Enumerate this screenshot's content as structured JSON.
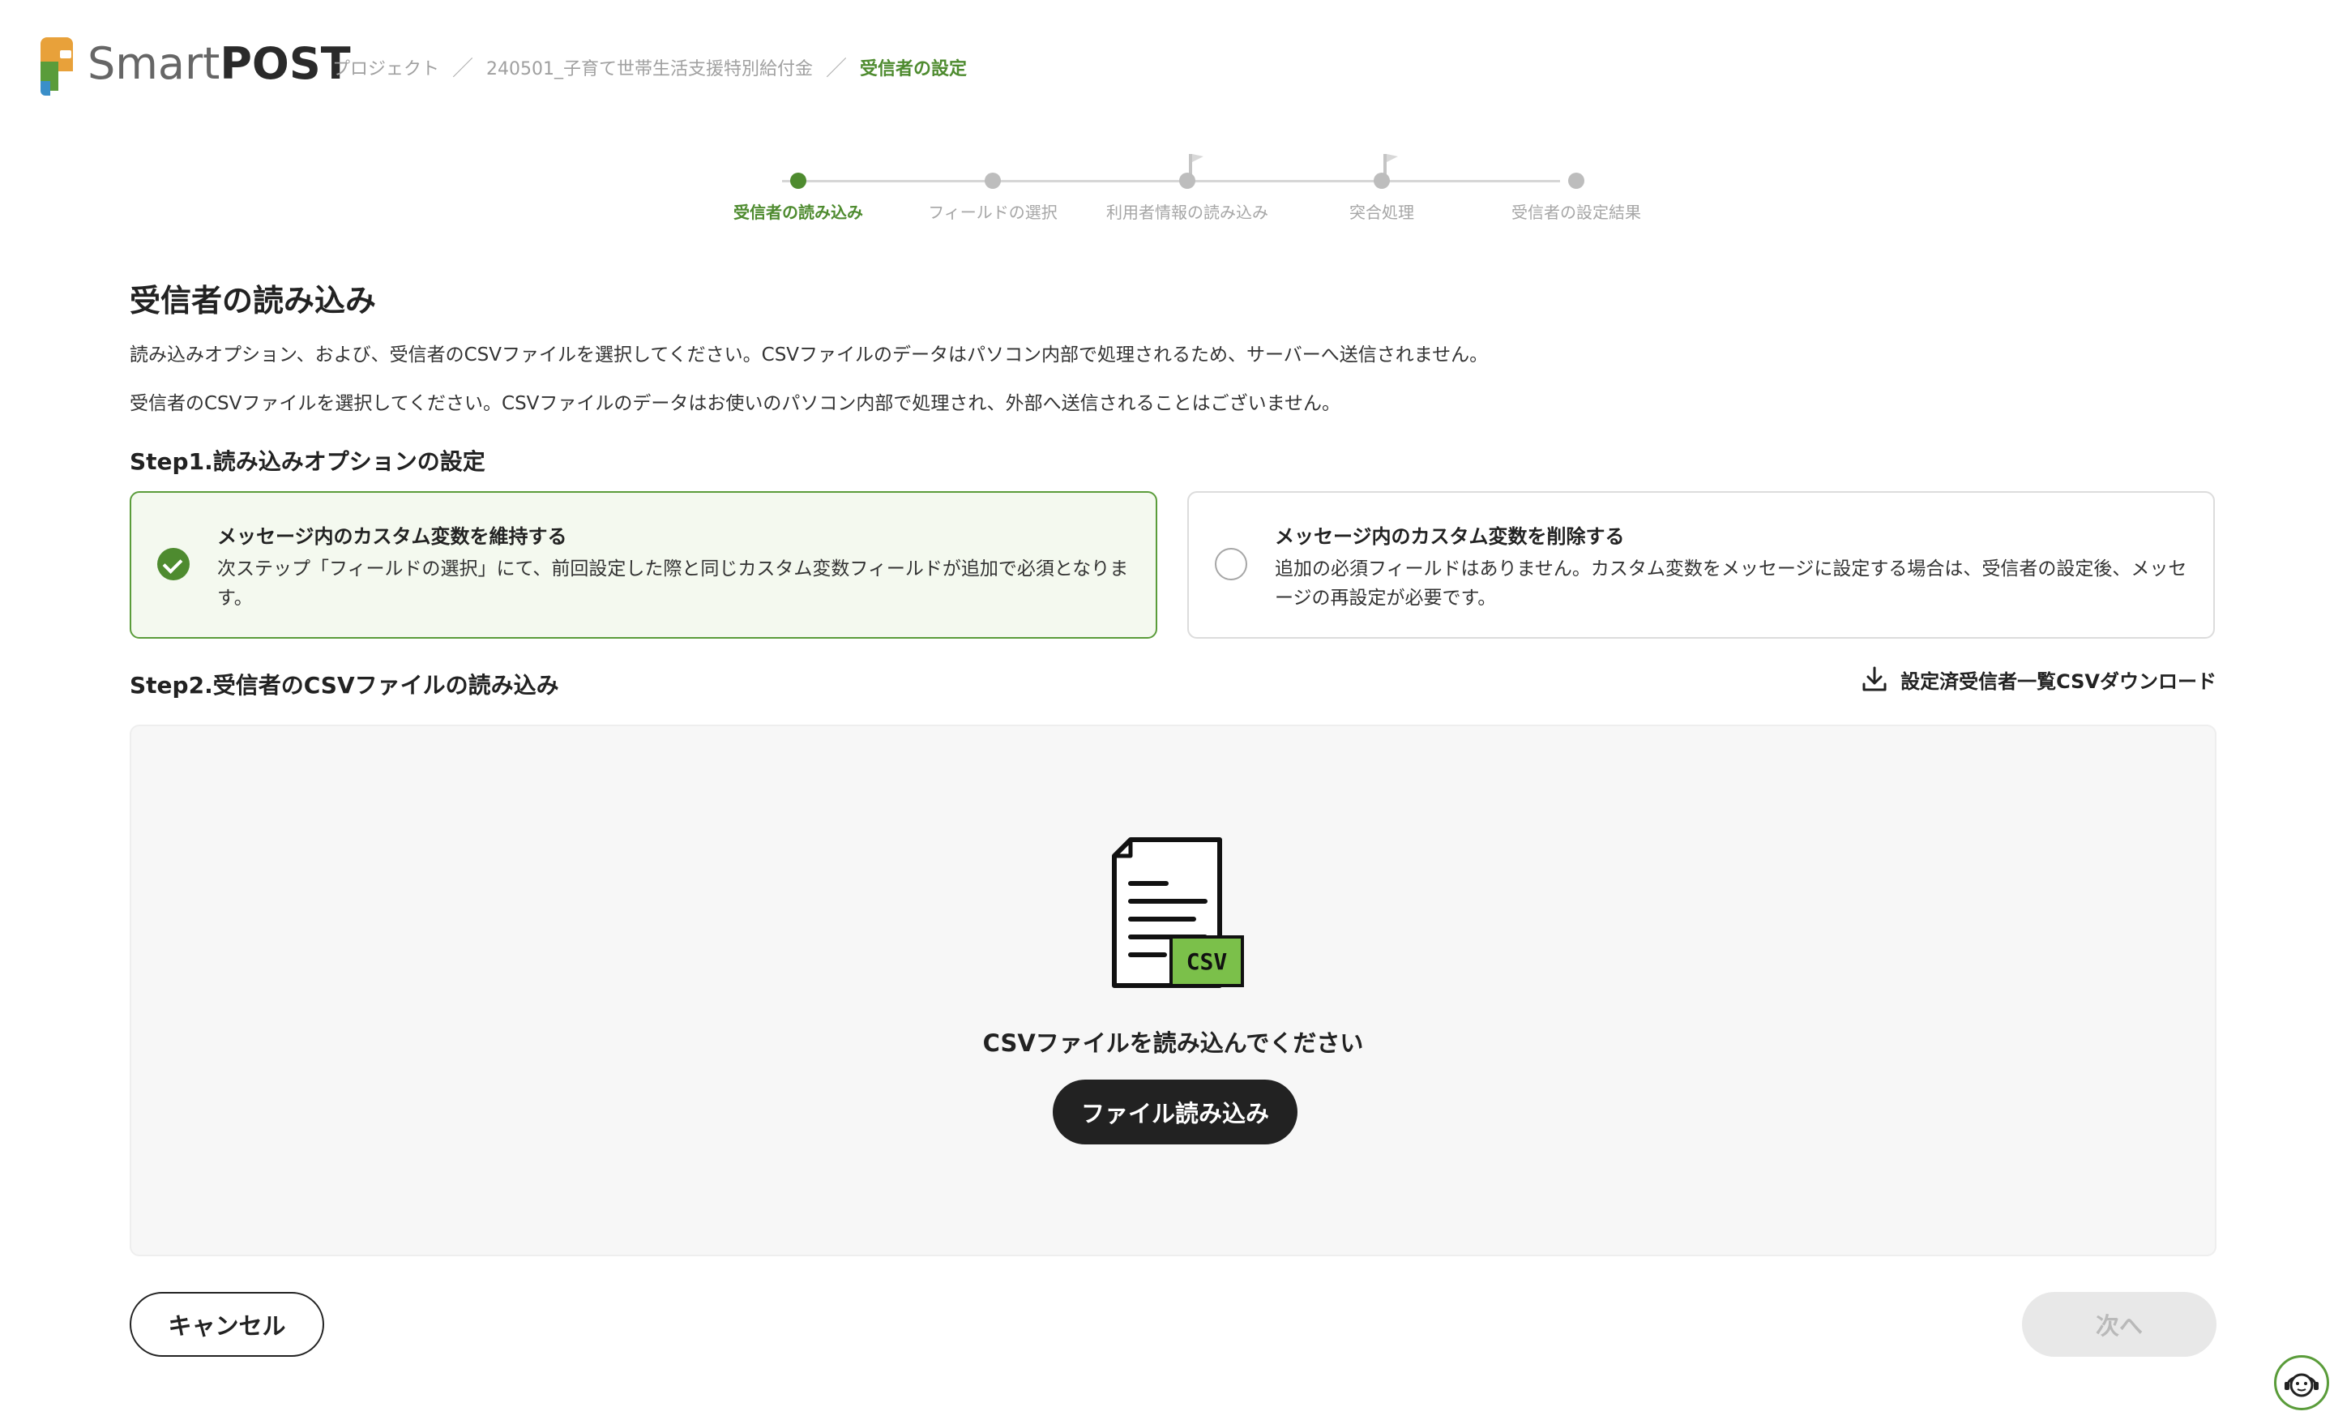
{
  "header": {
    "brand_light": "Smart",
    "brand_bold": "POST",
    "breadcrumb": [
      "プロジェクト",
      "240501_子育て世帯生活支援特別給付金",
      "受信者の設定"
    ]
  },
  "stepper": {
    "steps": [
      {
        "label": "受信者の読み込み",
        "active": true
      },
      {
        "label": "フィールドの選択",
        "active": false
      },
      {
        "label": "利用者情報の読み込み",
        "active": false
      },
      {
        "label": "突合処理",
        "active": false
      },
      {
        "label": "受信者の設定結果",
        "active": false
      }
    ]
  },
  "main": {
    "title": "受信者の読み込み",
    "desc1": "読み込みオプション、および、受信者のCSVファイルを選択してください。CSVファイルのデータはパソコン内部で処理されるため、サーバーへ送信されません。",
    "desc2": "受信者のCSVファイルを選択してください。CSVファイルのデータはお使いのパソコン内部で処理され、外部へ送信されることはございません。",
    "step1_heading": "Step1.読み込みオプションの設定",
    "options": [
      {
        "title": "メッセージ内のカスタム変数を維持する",
        "desc": "次ステップ「フィールドの選択」にて、前回設定した際と同じカスタム変数フィールドが追加で必須となります。",
        "selected": true
      },
      {
        "title": "メッセージ内のカスタム変数を削除する",
        "desc": "追加の必須フィールドはありません。カスタム変数をメッセージに設定する場合は、受信者の設定後、メッセージの再設定が必要です。",
        "selected": false
      }
    ],
    "step2_heading": "Step2.受信者のCSVファイルの読み込み",
    "download_label": "設定済受信者一覧CSVダウンロード",
    "dropzone": {
      "icon_text": "CSV",
      "text": "CSVファイルを読み込んでください",
      "button_label": "ファイル読み込み"
    },
    "cancel_label": "キャンセル",
    "next_label": "次へ"
  },
  "colors": {
    "accent": "#4e8b2f",
    "selected_bg": "#f4f9ef",
    "dark_button": "#222222",
    "disabled_button": "#e8e8e8"
  }
}
